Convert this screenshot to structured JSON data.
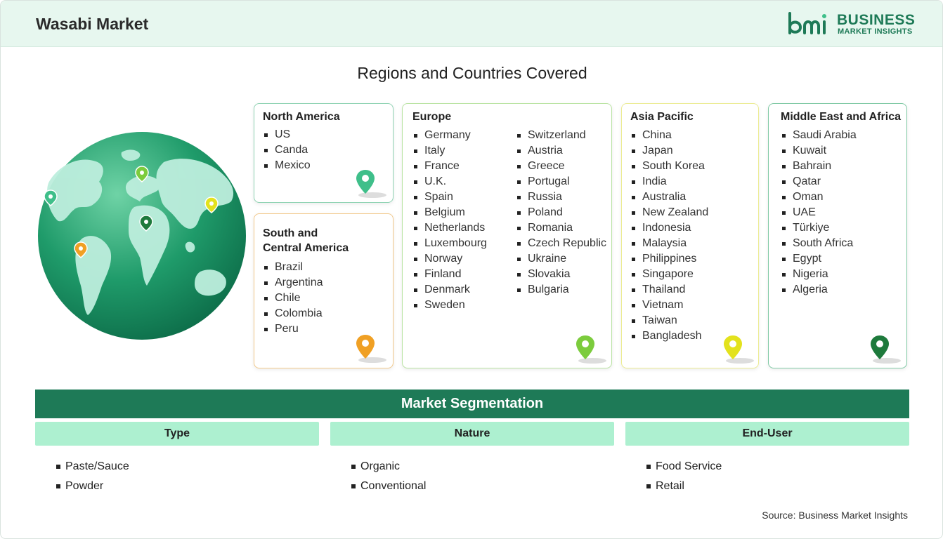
{
  "header": {
    "title": "Wasabi Market",
    "logo_line1": "BUSINESS",
    "logo_line2": "MARKET INSIGHTS"
  },
  "regions_title": "Regions and Countries Covered",
  "regions": {
    "north_america": {
      "name": "North America",
      "countries": [
        "US",
        "Canda",
        "Mexico"
      ],
      "pin_color": "#3fbf8a"
    },
    "south_central_america": {
      "name_line1": "South and",
      "name_line2": "Central America",
      "countries": [
        "Brazil",
        "Argentina",
        "Chile",
        "Colombia",
        "Peru"
      ],
      "pin_color": "#f0a024"
    },
    "europe": {
      "name": "Europe",
      "countries_col1": [
        "Germany",
        "Italy",
        "France",
        "U.K.",
        "Spain",
        "Belgium",
        "Netherlands",
        "Luxembourg",
        "Norway",
        "Finland",
        "Denmark",
        "Sweden"
      ],
      "countries_col2": [
        "Switzerland",
        "Austria",
        "Greece",
        "Portugal",
        "Russia",
        "Poland",
        "Romania",
        "Czech Republic",
        "Ukraine",
        "Slovakia",
        "Bulgaria"
      ],
      "pin_color": "#7ccc3d"
    },
    "asia_pacific": {
      "name": "Asia Pacific",
      "countries": [
        "China",
        "Japan",
        "South Korea",
        "India",
        "Australia",
        "New Zealand",
        "Indonesia",
        "Malaysia",
        "Philippines",
        "Singapore",
        "Thailand",
        "Vietnam",
        "Taiwan",
        "Bangladesh"
      ],
      "pin_color": "#e3e21d"
    },
    "middle_east_africa": {
      "name": "Middle East and Africa",
      "countries": [
        "Saudi Arabia",
        "Kuwait",
        "Bahrain",
        "Qatar",
        "Oman",
        "UAE",
        "Türkiye",
        "South Africa",
        "Egypt",
        "Nigeria",
        "Algeria"
      ],
      "pin_color": "#1e7a3c"
    }
  },
  "segmentation": {
    "title": "Market Segmentation",
    "columns": [
      {
        "heading": "Type",
        "items": [
          "Paste/Sauce",
          "Powder"
        ]
      },
      {
        "heading": "Nature",
        "items": [
          "Organic",
          "Conventional"
        ]
      },
      {
        "heading": "End-User",
        "items": [
          "Food Service",
          "Retail"
        ]
      }
    ]
  },
  "source": "Source: Business Market Insights",
  "colors": {
    "brand_green": "#1e7a57",
    "segment_header_bg": "#adf0d0",
    "header_bg": "#e7f7ef"
  }
}
